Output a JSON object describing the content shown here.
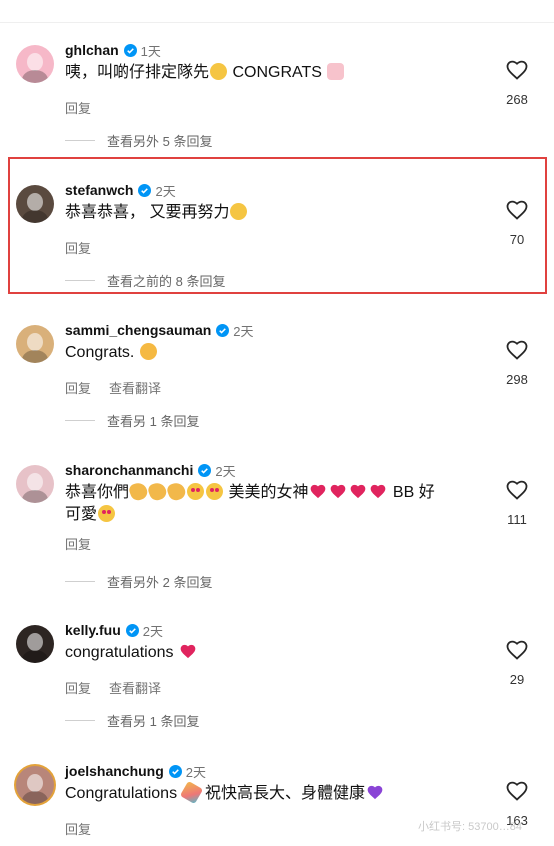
{
  "comments": [
    {
      "username": "ghlchan",
      "time": "1天",
      "text_prefix": "咦，叫啲仔排定隊先",
      "text_suffix": " CONGRATS ",
      "actions": [
        "回复"
      ],
      "likes": "268",
      "replies": "查看另外 5 条回复",
      "avatar_color": "#f6b8c8"
    },
    {
      "username": "stefanwch",
      "time": "2天",
      "text": "恭喜恭喜， 又要再努力",
      "actions": [
        "回复"
      ],
      "likes": "70",
      "replies": "查看之前的 8 条回复",
      "avatar_color": "#5a4a3f"
    },
    {
      "username": "sammi_chengsauman",
      "time": "2天",
      "text": "Congrats. ",
      "actions": [
        "回复",
        "查看翻译"
      ],
      "likes": "298",
      "replies": "查看另 1 条回复",
      "avatar_color": "#d9b07a"
    },
    {
      "username": "sharonchanmanchi",
      "time": "2天",
      "text_a": "恭喜你們",
      "text_b": " 美美的女神",
      "text_c": " BB 好",
      "text_line2": "可愛",
      "actions": [
        "回复"
      ],
      "likes": "111",
      "replies": "查看另外 2 条回复",
      "avatar_color": "#e7c2c8"
    },
    {
      "username": "kelly.fuu",
      "time": "2天",
      "text": "congratulations ",
      "actions": [
        "回复",
        "查看翻译"
      ],
      "likes": "29",
      "replies": "查看另 1 条回复",
      "avatar_color": "#2d2522"
    },
    {
      "username": "joelshanchung",
      "time": "2天",
      "text_a": "Congratulations ",
      "text_b": " 祝快高長大、身體健康",
      "actions": [
        "回复"
      ],
      "likes": "163",
      "avatar_color": "#b8867a"
    }
  ],
  "watermark": "小红书号: 53700…84",
  "colors": {
    "highlight": "#e0413f",
    "verified": "#0095f6",
    "heart": "#e0245e",
    "purple_heart": "#8a44d6"
  }
}
